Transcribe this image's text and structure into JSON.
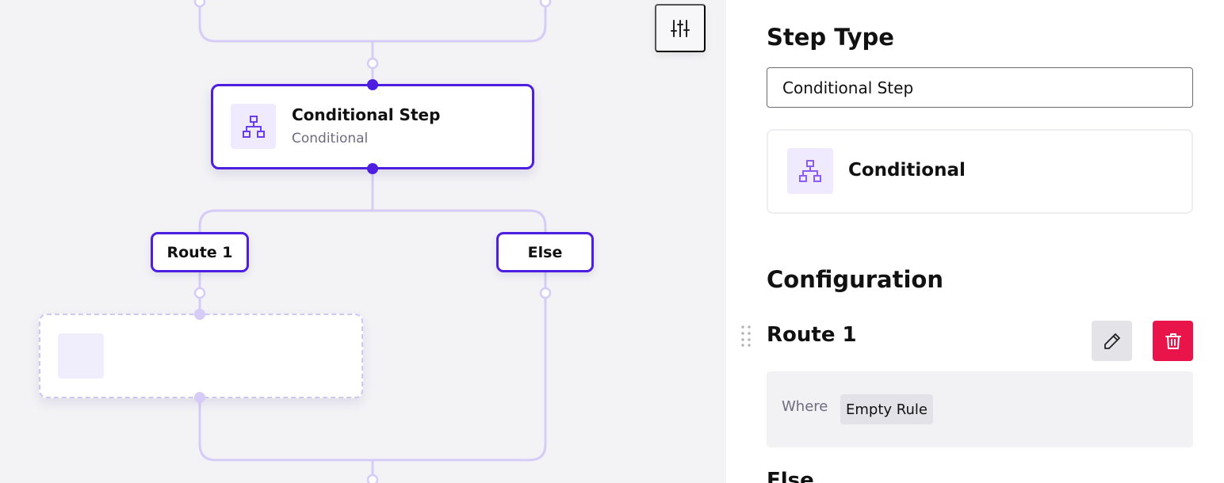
{
  "canvas": {
    "node": {
      "title": "Conditional Step",
      "subtitle": "Conditional",
      "icon": "sitemap-icon"
    },
    "routes": [
      {
        "label": "Route 1"
      },
      {
        "label": "Else"
      }
    ],
    "settings_icon": "sliders-icon",
    "colors": {
      "accent": "#4d1de0",
      "connector": "#d6ccf7",
      "icon": "#6b3df0"
    }
  },
  "panel": {
    "step_type_heading": "Step Type",
    "step_type_value": "Conditional Step",
    "type_card": {
      "label": "Conditional",
      "icon": "sitemap-icon"
    },
    "configuration_heading": "Configuration",
    "route": {
      "title": "Route 1",
      "where_label": "Where",
      "rule": "Empty Rule",
      "edit_icon": "pencil-icon",
      "delete_icon": "trash-icon"
    },
    "else_heading": "Else",
    "colors": {
      "delete": "#e8144a"
    }
  }
}
